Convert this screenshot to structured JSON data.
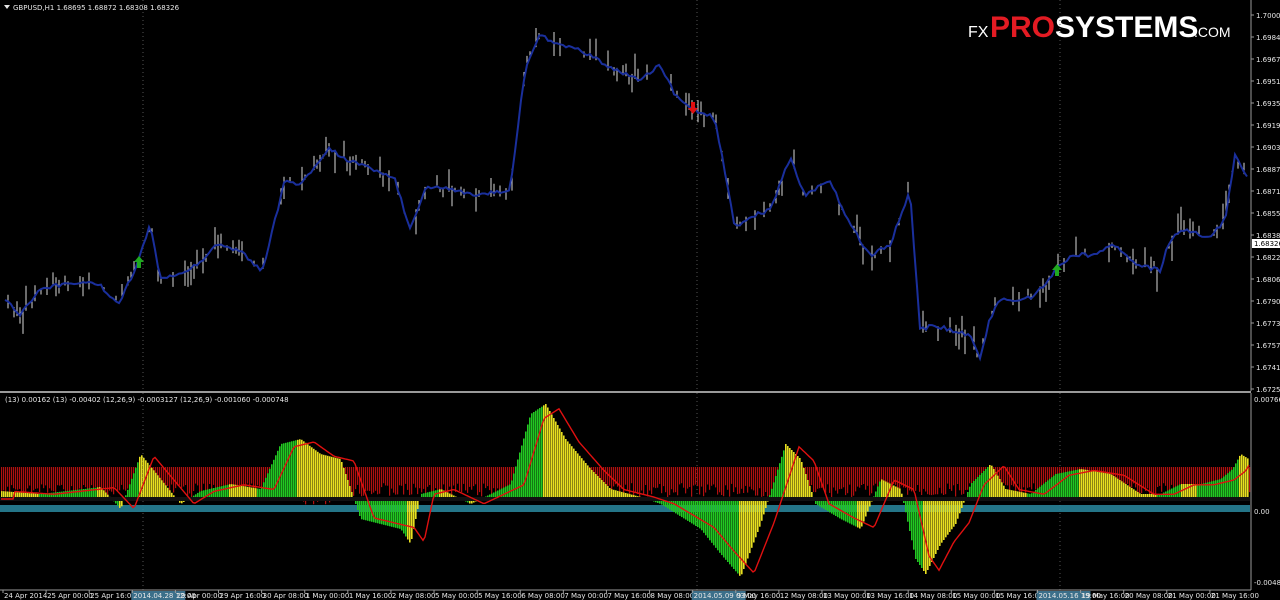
{
  "header": {
    "symbol_menu_icon": "triangle-down-icon",
    "quote": "GBPUSD,H1  1.68695 1.68872 1.68308 1.68326"
  },
  "logo": {
    "fx": "FX",
    "pro": "PRO",
    "systems": "SYSTEMS",
    "com": ".COM"
  },
  "price_axis": {
    "labels": [
      "1.70000",
      "1.69840",
      "1.69675",
      "1.69515",
      "1.69355",
      "1.69195",
      "1.69030",
      "1.68870",
      "1.68710",
      "1.68550",
      "1.68385",
      "1.68225",
      "1.68065",
      "1.67900",
      "1.67735",
      "1.67575",
      "1.67415",
      "1.67250"
    ],
    "current_price": "1.68326"
  },
  "indicator_header": "(13) 0.00162  (13) -0.00402  (12,26,9) -0.0003127  (12,26,9) -0.001060 -0.000748",
  "indicator_axis": {
    "labels": [
      "0.00766",
      "0.00",
      "-0.00485"
    ]
  },
  "time_axis": {
    "labels": [
      "24 Apr 2014",
      "25 Apr 00:00",
      "25 Apr 16:00",
      "2014.04.28 12:00",
      "29 Apr 00:00",
      "29 Apr 16:00",
      "30 Apr 08:00",
      "1 May 00:00",
      "1 May 16:00",
      "2 May 08:00",
      "5 May 00:00",
      "5 May 16:00",
      "6 May 08:00",
      "7 May 00:00",
      "7 May 16:00",
      "8 May 08:00",
      "2014.05.09 03:00",
      "9 May 16:00",
      "12 May 08:00",
      "13 May 00:00",
      "13 May 16:00",
      "14 May 08:00",
      "15 May 00:00",
      "15 May 16:00",
      "2014.05.16 19:00",
      "19 May 16:00",
      "20 May 08:00",
      "21 May 00:00",
      "21 May 16:00"
    ],
    "highlighted": [
      "2014.04.28 12:00",
      "2014.05.09 03:00",
      "2014.05.16 19:00"
    ]
  },
  "signals": [
    {
      "type": "buy",
      "icon": "arrow-up-icon",
      "color": "#1fa81f"
    },
    {
      "type": "sell",
      "icon": "arrow-down-icon",
      "color": "#e01010"
    },
    {
      "type": "buy",
      "icon": "arrow-up-icon",
      "color": "#1fa81f"
    }
  ],
  "colors": {
    "background": "#000000",
    "price_line": "#1a2f9c",
    "bull_wick": "#d9d9d9",
    "histogram_red": "#b01010",
    "histogram_green": "#22c722",
    "histogram_yellow": "#e8e020",
    "signal_line": "#e01010",
    "teal_band": "#2a8aa0",
    "axis_text": "#e6e6e6",
    "grid_divider": "#9a9a9a"
  }
}
